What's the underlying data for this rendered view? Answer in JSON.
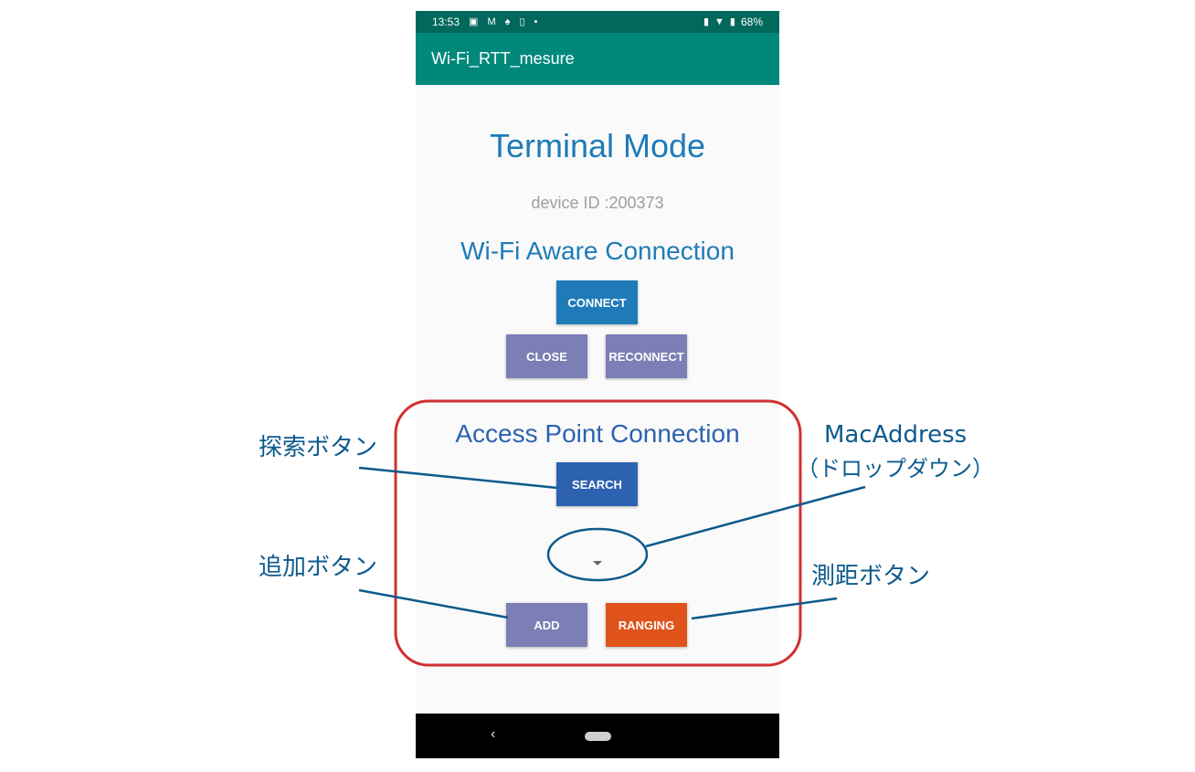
{
  "status_bar": {
    "time": "13:53",
    "battery": "68%",
    "left_icons": [
      "image-icon",
      "gmail-icon",
      "keyhole-icon",
      "phone-icon",
      "dot-icon"
    ],
    "right_icons": [
      "vibrate-icon",
      "wifi-icon",
      "battery-icon"
    ]
  },
  "app_bar": {
    "title": "Wi-Fi_RTT_mesure"
  },
  "main": {
    "heading": "Terminal Mode",
    "device_id": "device ID :200373",
    "aware_section": {
      "heading": "Wi-Fi Aware Connection",
      "connect_label": "CONNECT",
      "close_label": "CLOSE",
      "reconnect_label": "RECONNECT"
    },
    "ap_section": {
      "heading": "Access Point Connection",
      "search_label": "SEARCH",
      "spinner_value": "",
      "add_label": "ADD",
      "ranging_label": "RANGING"
    }
  },
  "annotations": {
    "search": "探索ボタン",
    "mac_line1": "MacAddress",
    "mac_line2": "（ドロップダウン）",
    "add": "追加ボタン",
    "ranging": "測距ボタン"
  },
  "colors": {
    "status_bar": "#00695c",
    "app_bar": "#00897b",
    "connect": "#1e7bb8",
    "close": "#7b7fb5",
    "reconnect": "#7b7fb5",
    "search": "#2d62b0",
    "add": "#7b7fb5",
    "ranging": "#e0541c",
    "highlight_box": "#d32f2f",
    "annotation": "#0d5a8c"
  }
}
